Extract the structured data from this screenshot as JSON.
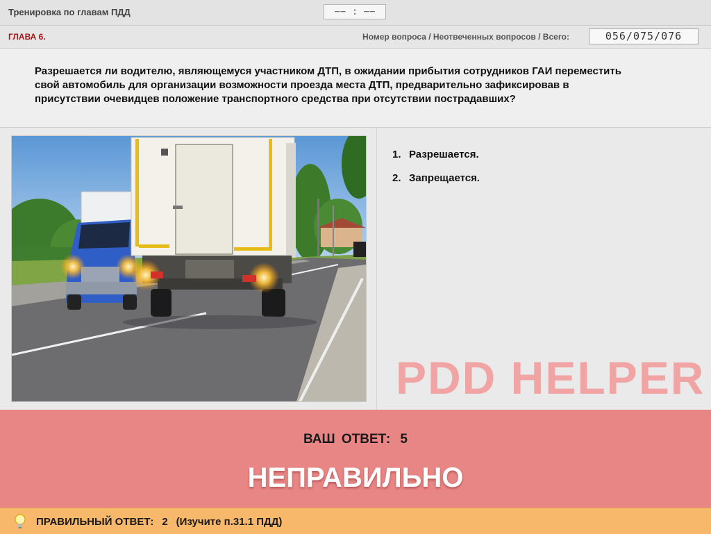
{
  "header": {
    "app_title": "Тренировка по главам ПДД",
    "timer": "−− : −−"
  },
  "chapter": {
    "title": "ГЛАВА 6.",
    "counter_label": "Номер вопроса / Неотвеченных вопросов / Всего:",
    "counter_value": "056/075/076"
  },
  "question": {
    "text": "Разрешается ли водителю, являющемуся участником ДТП, в ожидании прибытия сотрудников ГАИ переместить свой автомобиль для организации возможности проезда места ДТП, предварительно зафиксировав в присутствии очевидцев положение транспортного средства при отсутствии пострадавших?"
  },
  "answers": [
    {
      "number": "1.",
      "text": "Разрешается."
    },
    {
      "number": "2.",
      "text": "Запрещается."
    }
  ],
  "watermark": "PDD HELPER",
  "result": {
    "your_answer_label": "ВАШ ОТВЕТ:",
    "your_answer_value": "5",
    "verdict": "НЕПРАВИЛЬНО",
    "color": "#e88686"
  },
  "correct": {
    "label": "ПРАВИЛЬНЫЙ ОТВЕТ:",
    "value": "2",
    "hint": "(Изучите п.31.1 ПДД)",
    "color": "#f7b86b"
  },
  "icons": {
    "bulb": "lightbulb-icon"
  }
}
